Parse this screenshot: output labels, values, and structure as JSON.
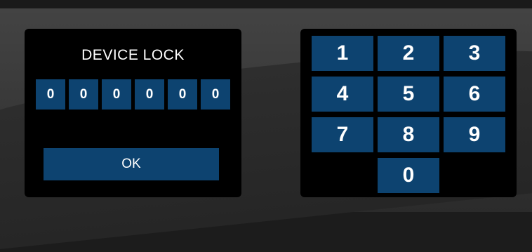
{
  "lock": {
    "title": "DEVICE LOCK",
    "digits": [
      "0",
      "0",
      "0",
      "0",
      "0",
      "0"
    ],
    "ok_label": "OK"
  },
  "keypad": {
    "keys": [
      "1",
      "2",
      "3",
      "4",
      "5",
      "6",
      "7",
      "8",
      "9",
      "0"
    ]
  },
  "colors": {
    "accent": "#0d4370",
    "panel": "#000000",
    "background": "#3a3a3a"
  }
}
